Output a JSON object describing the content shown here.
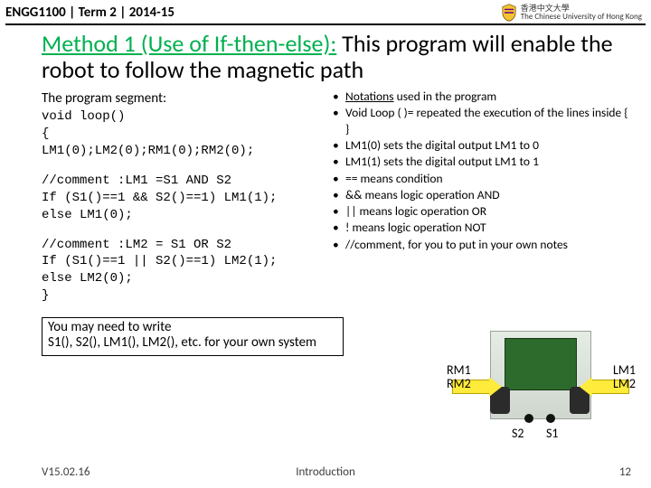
{
  "header": {
    "course": "ENGG1100 | Term 2 | 2014-15",
    "uni_en": "The Chinese University of Hong Kong",
    "uni_zh": "香港中文大學"
  },
  "title": {
    "method": "Method 1 (Use of If-then-else):",
    "rest": " This program will enable the robot to follow the magnetic path"
  },
  "left": {
    "segment_label": "The program segment:",
    "code1": "void loop()\n{\nLM1(0);LM2(0);RM1(0);RM2(0);",
    "code2": "//comment :LM1 =S1 AND S2\nIf (S1()==1 && S2()==1) LM1(1);\nelse LM1(0);",
    "code3": "//comment :LM2 = S1 OR S2\nIf (S1()==1 || S2()==1) LM2(1);\nelse LM2(0);\n}",
    "note_line1": "You may need to write",
    "note_line2": "S1(), S2(), LM1(), LM2(), etc. for your own system"
  },
  "right": {
    "notes_label": "Notations",
    "notes_label_rest": " used in the program",
    "items": [
      "Void Loop ( )= repeated the execution of the lines inside { }",
      "LM1(0) sets the digital output LM1 to 0",
      "LM1(1) sets the digital output LM1 to 1",
      "== means condition",
      "&& means logic operation AND",
      "|| means logic operation OR",
      "! means logic operation NOT",
      "//comment, for you to put in your own notes"
    ]
  },
  "robot": {
    "rm1": "RM1",
    "rm2": "RM2",
    "lm1": "LM1",
    "lm2": "LM2",
    "s1": "S1",
    "s2": "S2"
  },
  "footer": {
    "version": "V15.02.16",
    "center": "Introduction",
    "page": "12"
  }
}
